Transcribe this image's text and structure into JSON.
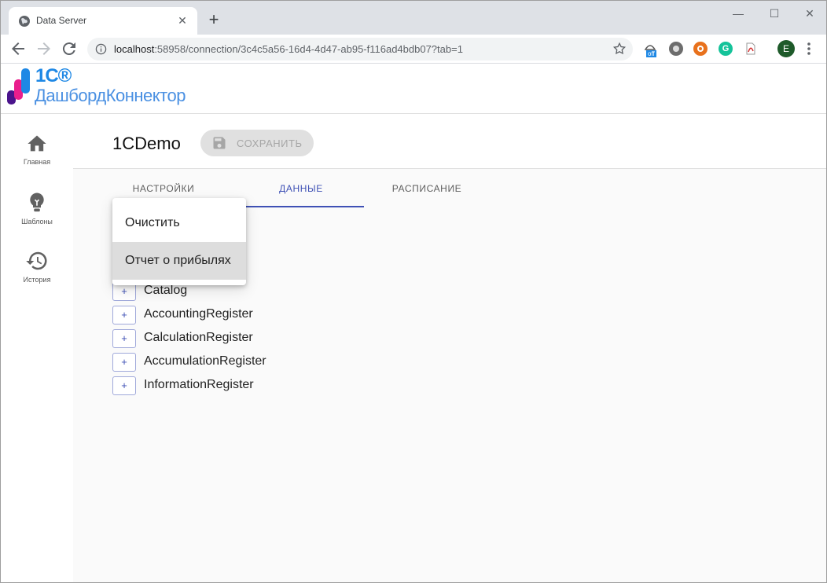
{
  "browser": {
    "tab_title": "Data Server",
    "new_tab": "+",
    "url_host": "localhost",
    "url_rest": ":58958/connection/3c4c5a56-16d4-4d47-ab95-f116ad4bdb07?tab=1",
    "extension_badge": "off",
    "avatar_letter": "E"
  },
  "app": {
    "logo_top": "1С®",
    "logo_name": "ДашбордКоннектор"
  },
  "sidebar": {
    "items": [
      {
        "label": "Главная",
        "icon": "home-icon"
      },
      {
        "label": "Шаблоны",
        "icon": "lightbulb-icon"
      },
      {
        "label": "История",
        "icon": "history-icon"
      }
    ]
  },
  "main": {
    "title": "1CDemo",
    "save_label": "СОХРАНИТЬ",
    "tabs": [
      {
        "label": "НАСТРОЙКИ"
      },
      {
        "label": "ДАННЫЕ"
      },
      {
        "label": "РАСПИСАНИЕ"
      }
    ],
    "active_tab": "ДАННЫЕ",
    "tree": [
      {
        "toggle": "+",
        "label": "Catalog"
      },
      {
        "toggle": "+",
        "label": "AccountingRegister"
      },
      {
        "toggle": "+",
        "label": "CalculationRegister"
      },
      {
        "toggle": "+",
        "label": "AccumulationRegister"
      },
      {
        "toggle": "+",
        "label": "InformationRegister"
      }
    ]
  },
  "menu": {
    "items": [
      {
        "label": "Очистить"
      },
      {
        "label": "Отчет о прибылях"
      }
    ]
  },
  "colors": {
    "accent": "#3f51b5",
    "logo_blue": "#1e88e5"
  }
}
